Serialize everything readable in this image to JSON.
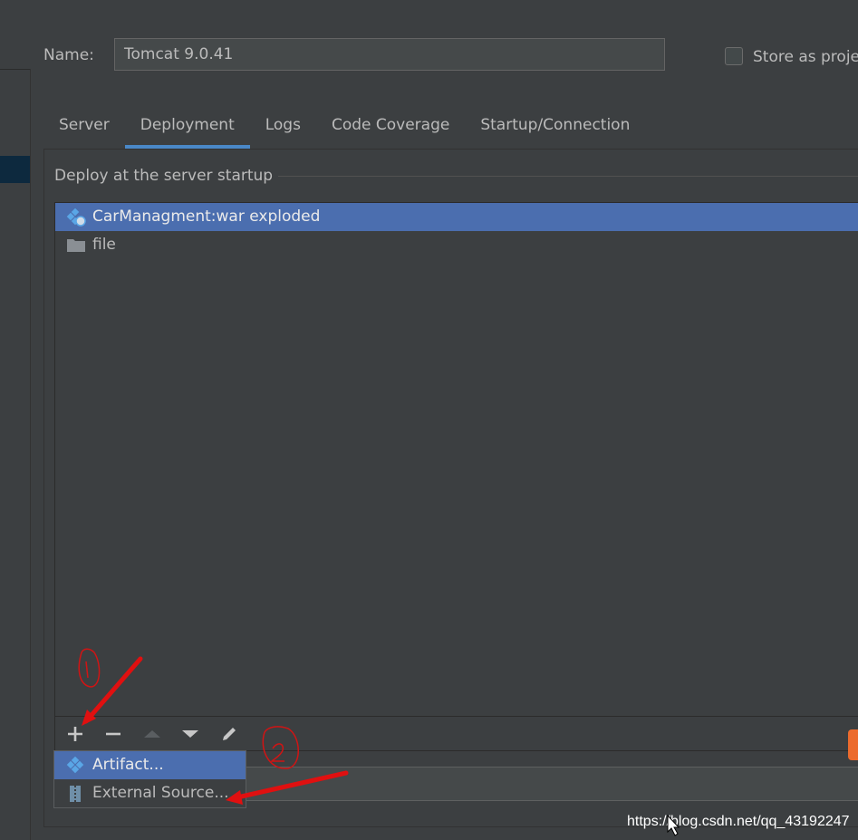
{
  "form": {
    "name_label": "Name:",
    "name_value": "Tomcat 9.0.41",
    "store_label": "Store as projec"
  },
  "tabs": [
    {
      "label": "Server"
    },
    {
      "label": "Deployment",
      "active": true
    },
    {
      "label": "Logs"
    },
    {
      "label": "Code Coverage"
    },
    {
      "label": "Startup/Connection"
    }
  ],
  "deploy": {
    "section_title": "Deploy at the server startup",
    "items": [
      {
        "label": "CarManagment:war exploded",
        "icon": "artifact-icon",
        "selected": true
      },
      {
        "label": "file",
        "icon": "folder-icon",
        "selected": false
      }
    ]
  },
  "toolbar": {
    "buttons": [
      {
        "icon": "plus-icon"
      },
      {
        "icon": "minus-icon"
      },
      {
        "icon": "move-up-icon"
      },
      {
        "icon": "move-down-icon"
      },
      {
        "icon": "edit-icon"
      }
    ]
  },
  "popup_menu": {
    "items": [
      {
        "label": "Artifact...",
        "icon": "artifact-icon",
        "selected": true
      },
      {
        "label": "External Source...",
        "icon": "archive-icon",
        "selected": false
      }
    ]
  },
  "watermark": "https://blog.csdn.net/qq_43192247",
  "colors": {
    "background": "#3c3f41",
    "selection": "#4b6eaf",
    "tab_underline": "#4a88c7",
    "annotation": "#e01010"
  }
}
